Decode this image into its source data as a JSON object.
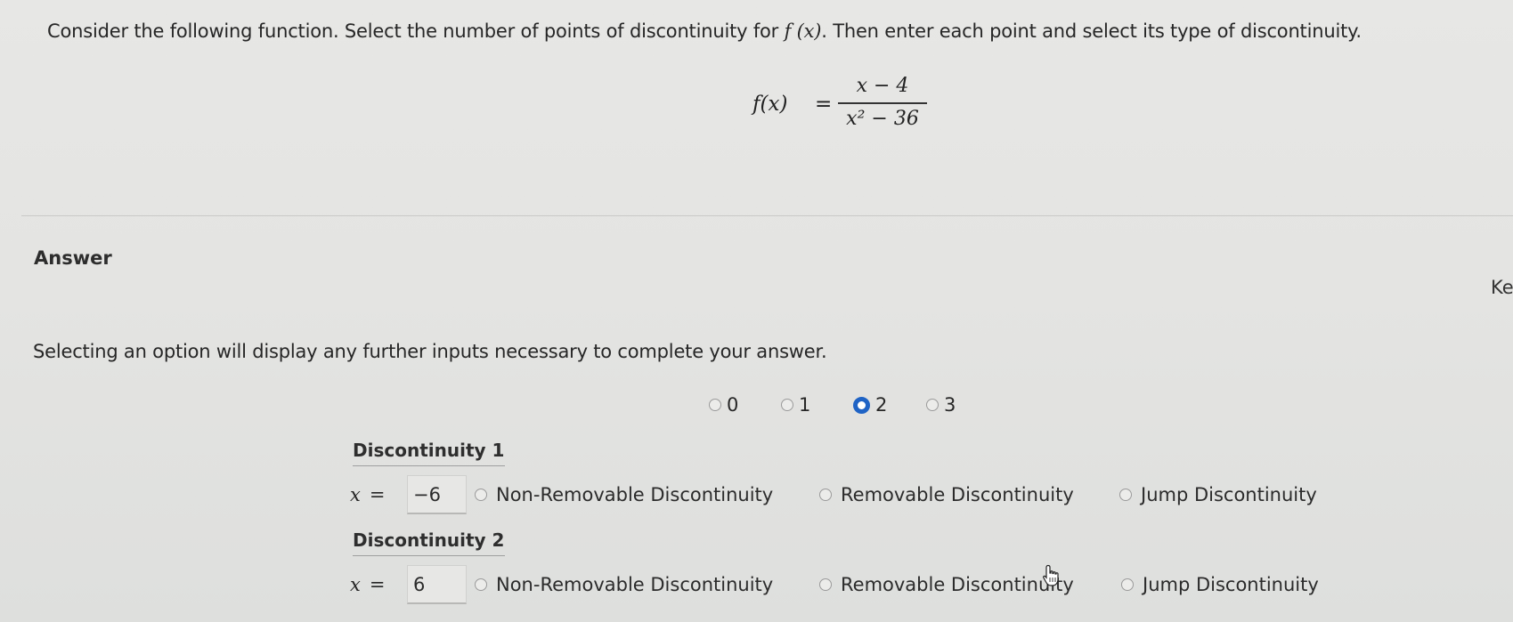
{
  "question": {
    "prefix": "Consider the following function. Select the number of points of discontinuity for ",
    "fx": "f (x)",
    "suffix": ". Then enter each point and select its type of discontinuity."
  },
  "formula": {
    "lhs": "f(x)",
    "equals": "=",
    "numerator": "x − 4",
    "denominator": "x² − 36"
  },
  "answer_heading": "Answer",
  "side_label": "Ke",
  "instruction": "Selecting an option will display any further inputs necessary to complete your answer.",
  "count_options": [
    {
      "label": "0",
      "selected": false
    },
    {
      "label": "1",
      "selected": false
    },
    {
      "label": "2",
      "selected": true
    },
    {
      "label": "3",
      "selected": false
    }
  ],
  "x_label": "x",
  "equals_sign": "=",
  "discontinuities": [
    {
      "heading": "Discontinuity 1",
      "value": "−6",
      "types": [
        "Non-Removable Discontinuity",
        "Removable Discontinuity",
        "Jump Discontinuity"
      ]
    },
    {
      "heading": "Discontinuity 2",
      "value": "6",
      "types": [
        "Non-Removable Discontinuity",
        "Removable Discontinuity",
        "Jump Discontinuity"
      ]
    }
  ],
  "colors": {
    "selected_radio": "#1f63c5",
    "background": "#e5e5e3"
  }
}
